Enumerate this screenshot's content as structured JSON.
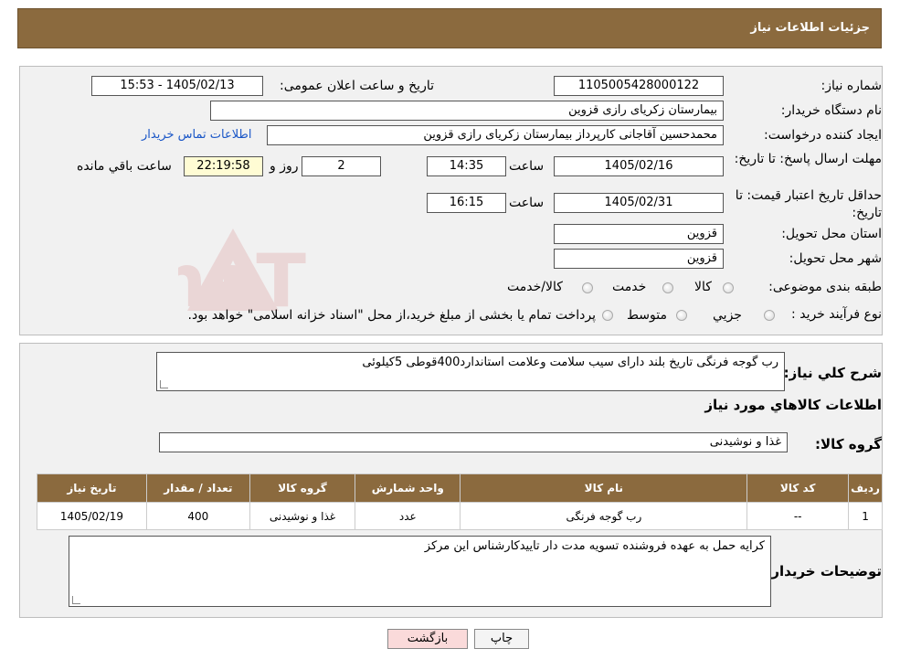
{
  "header": {
    "title": "جزئیات اطلاعات نیاز"
  },
  "form": {
    "need_number_label": "شماره نیاز:",
    "need_number": "1105005428000122",
    "announce_label": "تاریخ و ساعت اعلان عمومی:",
    "announce_value": "1405/02/13 - 15:53",
    "buyer_org_label": "نام دستگاه خریدار:",
    "buyer_org": "بیمارستان زکریای رازی قزوین",
    "creator_label": "ایجاد کننده درخواست:",
    "creator": "محمدحسین آقاجانی کارپرداز بیمارستان زکریای رازی قزوین",
    "contact_link": "اطلاعات تماس خریدار",
    "deadline_label": "مهلت ارسال پاسخ: تا تاریخ:",
    "deadline_date": "1405/02/16",
    "time_label": "ساعت",
    "deadline_time": "14:35",
    "days_value": "2",
    "days_label": "روز و",
    "remaining_time": "22:19:58",
    "remaining_label": "ساعت باقي مانده",
    "validity_label": "حداقل تاریخ اعتبار قیمت: تا تاریخ:",
    "validity_date": "1405/02/31",
    "validity_time": "16:15",
    "province_label": "استان محل تحویل:",
    "province": "قزوین",
    "city_label": "شهر محل تحویل:",
    "city": "قزوین",
    "category_label": "طبقه بندی موضوعی:",
    "category_options": [
      "کالا",
      "خدمت",
      "کالا/خدمت"
    ],
    "process_label": "نوع فرآیند خرید :",
    "process_options": [
      "جزیي",
      "متوسط"
    ],
    "process_note": "پرداخت تمام یا بخشی از مبلغ خرید،از محل \"اسناد خزانه اسلامی\" خواهد بود."
  },
  "details": {
    "summary_label": "شرح کلي نياز:",
    "summary": "رب گوجه فرنگی تاریخ بلند دارای سیب سلامت وعلامت استاندارد400قوطی 5کیلوئی",
    "goods_info_title": "اطلاعات کالاهاي مورد نياز",
    "group_label": "گروه کالا:",
    "group_value": "غذا و نوشیدنی",
    "table": {
      "headers": [
        "رديف",
        "کد کالا",
        "نام کالا",
        "واحد شمارش",
        "گروه کالا",
        "تعداد / مقدار",
        "تاریخ نیاز"
      ],
      "rows": [
        [
          "1",
          "--",
          "رب گوجه فرنگی",
          "عدد",
          "غذا و نوشیدنی",
          "400",
          "1405/02/19"
        ]
      ]
    },
    "buyer_notes_label": "توضيحات خريدار:",
    "buyer_notes": "کرایه حمل به عهده فروشنده تسویه مدت دار تاییدکارشناس این مرکز"
  },
  "buttons": {
    "print": "چاپ",
    "back": "بازگشت"
  },
  "watermark": {
    "text": "AriaTender.neT"
  }
}
